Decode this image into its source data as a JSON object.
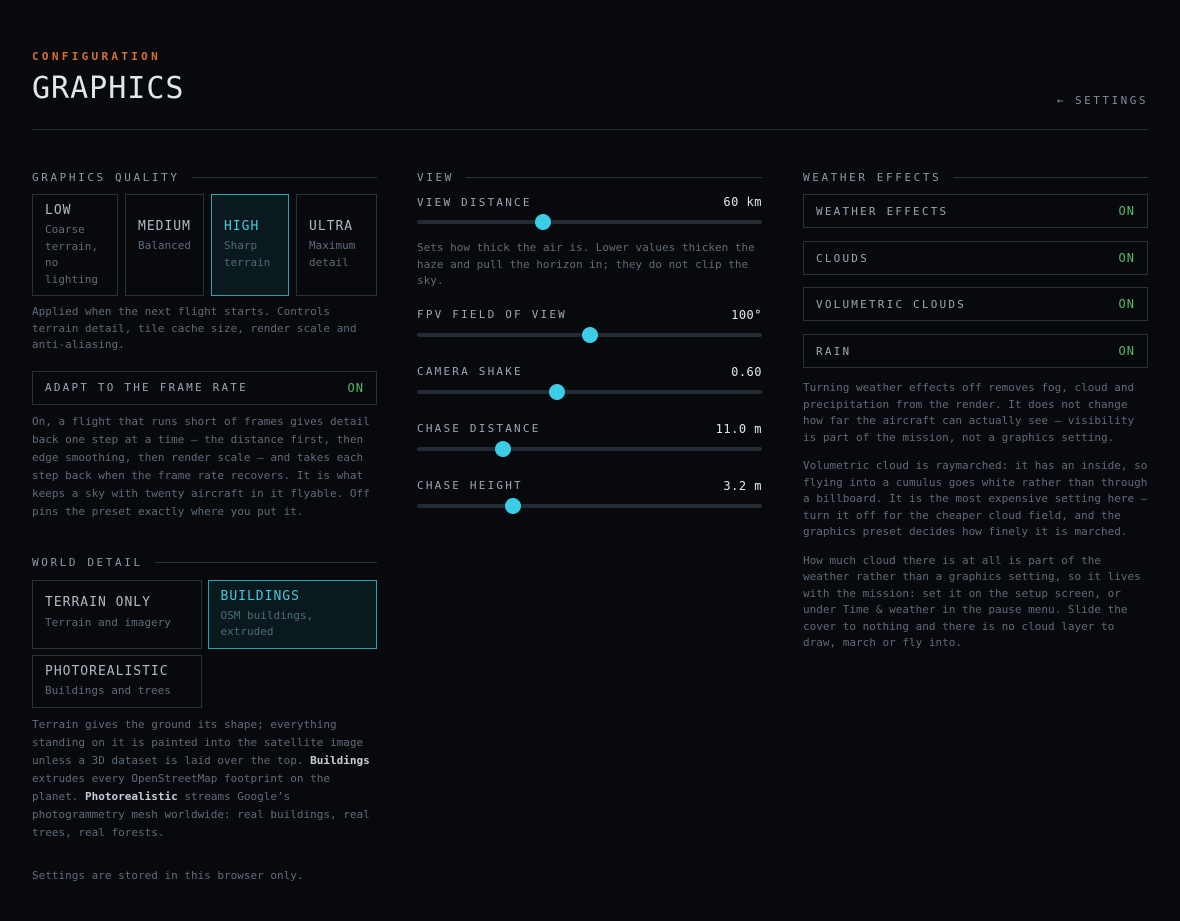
{
  "header": {
    "eyebrow": "CONFIGURATION",
    "title": "GRAPHICS",
    "back_link": "← SETTINGS"
  },
  "quality": {
    "heading": "GRAPHICS QUALITY",
    "options": [
      {
        "name": "LOW",
        "desc": "Coarse terrain, no lighting"
      },
      {
        "name": "MEDIUM",
        "desc": "Balanced"
      },
      {
        "name": "HIGH",
        "desc": "Sharp terrain",
        "selected": true
      },
      {
        "name": "ULTRA",
        "desc": "Maximum detail"
      }
    ],
    "note": "Applied when the next flight starts. Controls terrain detail, tile cache size, render scale and anti-aliasing."
  },
  "adapt": {
    "label": "ADAPT TO THE FRAME RATE",
    "state": "ON",
    "note": "On, a flight that runs short of frames gives detail back one step at a time — the distance first, then edge smoothing, then render scale — and takes each step back when the frame rate recovers. It is what keeps a sky with twenty aircraft in it flyable. Off pins the preset exactly where you put it."
  },
  "world": {
    "heading": "WORLD DETAIL",
    "options": [
      {
        "name": "TERRAIN ONLY",
        "desc": "Terrain and imagery"
      },
      {
        "name": "BUILDINGS",
        "desc": "OSM buildings, extruded",
        "selected": true
      },
      {
        "name": "PHOTOREALISTIC",
        "desc": "Buildings and trees"
      }
    ],
    "note_parts": {
      "p1": "Terrain gives the ground its shape; everything standing on it is painted into the satellite image unless a 3D dataset is laid over the top. ",
      "b1": "Buildings",
      "p2": " extrudes every OpenStreetMap footprint on the planet. ",
      "b2": "Photorealistic",
      "p3": " streams Google’s photogrammetry mesh worldwide: real buildings, real trees, real forests."
    }
  },
  "view": {
    "heading": "VIEW",
    "view_distance": {
      "label": "VIEW DISTANCE",
      "value": "60 km",
      "fraction": 0.365
    },
    "view_note": "Sets how thick the air is. Lower values thicken the haze and pull the horizon in; they do not clip the sky.",
    "sliders": [
      {
        "label": "FPV FIELD OF VIEW",
        "value": "100°",
        "fraction": 0.5
      },
      {
        "label": "CAMERA SHAKE",
        "value": "0.60",
        "fraction": 0.405
      },
      {
        "label": "CHASE DISTANCE",
        "value": "11.0 m",
        "fraction": 0.25
      },
      {
        "label": "CHASE HEIGHT",
        "value": "3.2 m",
        "fraction": 0.277
      }
    ]
  },
  "weather": {
    "heading": "WEATHER EFFECTS",
    "toggles": [
      {
        "label": "WEATHER EFFECTS",
        "state": "ON"
      },
      {
        "label": "CLOUDS",
        "state": "ON"
      },
      {
        "label": "VOLUMETRIC CLOUDS",
        "state": "ON"
      },
      {
        "label": "RAIN",
        "state": "ON"
      }
    ],
    "notes": [
      "Turning weather effects off removes fog, cloud and precipitation from the render. It does not change how far the aircraft can actually see — visibility is part of the mission, not a graphics setting.",
      "Volumetric cloud is raymarched: it has an inside, so flying into a cumulus goes white rather than through a billboard. It is the most expensive setting here — turn it off for the cheaper cloud field, and the graphics preset decides how finely it is marched.",
      "How much cloud there is at all is part of the weather rather than a graphics setting, so it lives with the mission: set it on the setup screen, or under Time & weather in the pause menu. Slide the cover to nothing and there is no cloud layer to draw, march or fly into."
    ]
  },
  "footer": "Settings are stored in this browser only.",
  "colors": {
    "accent": "#3ccde6",
    "eyebrow": "#d8722f",
    "on_state": "#57b862",
    "background": "#07090d"
  }
}
